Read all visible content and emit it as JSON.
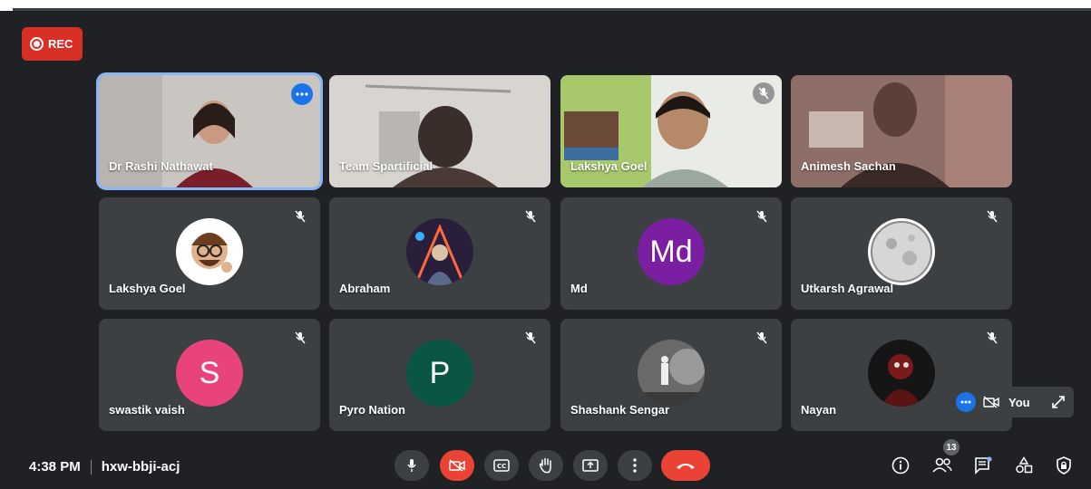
{
  "recording": {
    "label": "REC"
  },
  "participants": [
    {
      "name": "Dr Rashi Nathawat"
    },
    {
      "name": "Team Spartificial"
    },
    {
      "name": "Lakshya Goel"
    },
    {
      "name": "Animesh Sachan"
    },
    {
      "name": "Lakshya Goel"
    },
    {
      "name": "Abraham"
    },
    {
      "name": "Md",
      "initials": "Md"
    },
    {
      "name": "Utkarsh Agrawal"
    },
    {
      "name": "swastik vaish",
      "initials": "S"
    },
    {
      "name": "Pyro Nation",
      "initials": "P"
    },
    {
      "name": "Shashank Sengar"
    },
    {
      "name": "Nayan"
    }
  ],
  "self_view": {
    "label": "You"
  },
  "meeting": {
    "time": "4:38 PM",
    "code": "hxw-bbji-acj"
  },
  "people_count": "13",
  "colors": {
    "md": "#7b1fa2",
    "swastik": "#e8437a",
    "pyro": "#0b5545",
    "end": "#ea4335",
    "accent": "#1a73e8"
  },
  "icons": [
    "mic-icon",
    "camera-off-icon",
    "captions-icon",
    "raise-hand-icon",
    "present-icon",
    "more-vert-icon",
    "end-call-icon",
    "info-icon",
    "people-icon",
    "chat-icon",
    "activities-icon",
    "host-controls-icon"
  ]
}
